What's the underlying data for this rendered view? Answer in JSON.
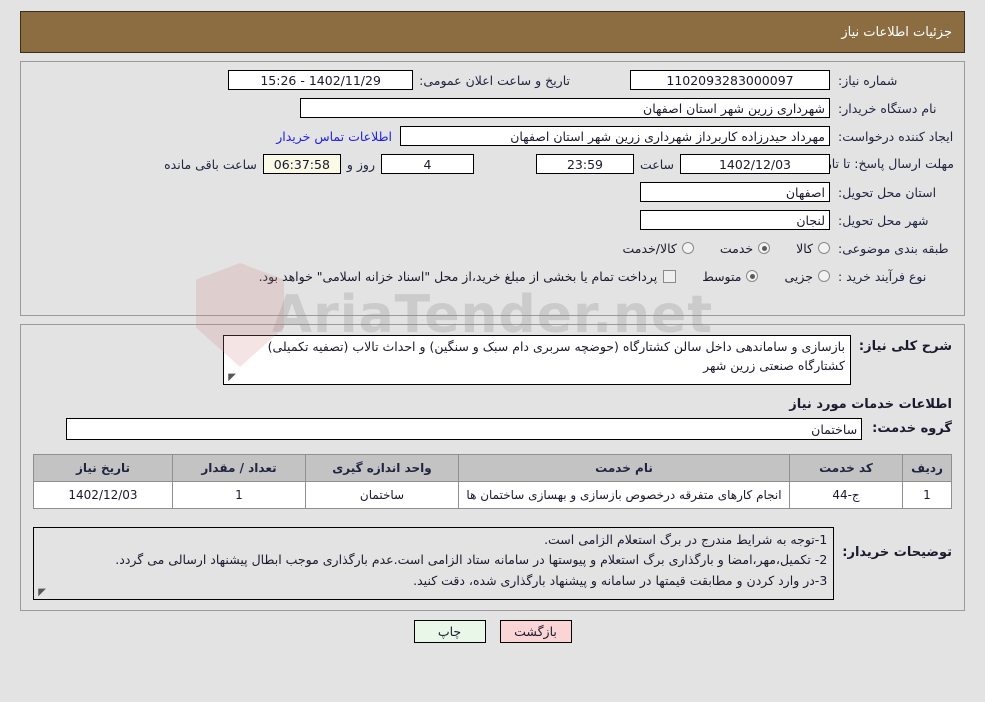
{
  "header": {
    "title": "جزئیات اطلاعات نیاز"
  },
  "form": {
    "need_number_label": "شماره نیاز:",
    "need_number_value": "1102093283000097",
    "announce_datetime_label": "تاریخ و ساعت اعلان عمومی:",
    "announce_datetime_value": "1402/11/29 - 15:26",
    "buyer_org_label": "نام دستگاه خریدار:",
    "buyer_org_value": "شهرداری زرین شهر استان اصفهان",
    "creator_label": "ایجاد کننده درخواست:",
    "creator_value": "مهرداد حیدرزاده کاربرداز شهرداری زرین شهر استان اصفهان",
    "buyer_contact_link": "اطلاعات تماس خریدار",
    "deadline_label": "مهلت ارسال پاسخ: تا تاریخ:",
    "deadline_date": "1402/12/03",
    "hour_label": "ساعت",
    "deadline_time": "23:59",
    "days_remaining": "4",
    "days_label": "روز و",
    "timer_value": "06:37:58",
    "remaining_label": "ساعت باقی مانده",
    "province_label": "استان محل تحویل:",
    "province_value": "اصفهان",
    "city_label": "شهر محل تحویل:",
    "city_value": "لنجان",
    "category_label": "طبقه بندی موضوعی:",
    "category_options": [
      {
        "label": "کالا",
        "selected": false
      },
      {
        "label": "خدمت",
        "selected": true
      },
      {
        "label": "کالا/خدمت",
        "selected": false
      }
    ],
    "process_label": "نوع فرآیند خرید :",
    "process_options": [
      {
        "label": "جزیی",
        "selected": false
      },
      {
        "label": "متوسط",
        "selected": true
      }
    ],
    "treasury_checkbox_checked": false,
    "treasury_text": "پرداخت تمام یا بخشی از مبلغ خرید،از محل \"اسناد خزانه اسلامی\" خواهد بود."
  },
  "description": {
    "label": "شرح کلی نیاز:",
    "value": "بازسازی و ساماندهی داخل سالن کشتارگاه (حوضچه سربری دام سبک و سنگین) و احداث تالاب (تصفیه تکمیلی) کشتارگاه صنعتی زرین شهر"
  },
  "services_section": {
    "heading": "اطلاعات خدمات مورد نیاز",
    "group_label": "گروه خدمت:",
    "group_value": "ساختمان"
  },
  "table": {
    "columns": [
      "ردیف",
      "کد خدمت",
      "نام خدمت",
      "واحد اندازه گیری",
      "تعداد / مقدار",
      "تاریخ نیاز"
    ],
    "rows": [
      {
        "row_no": "1",
        "service_code": "ج-44",
        "service_name": "انجام کارهای متفرقه درخصوص بازسازی و بهسازی ساختمان ها",
        "unit": "ساختمان",
        "quantity": "1",
        "need_date": "1402/12/03"
      }
    ]
  },
  "notes": {
    "label": "توضیحات خریدار:",
    "lines": [
      "1-توجه به شرایط مندرج در برگ استعلام الزامی است.",
      "2- تکمیل،مهر،امضا و بارگذاری برگ استعلام و پیوستها در سامانه ستاد الزامی است.عدم بارگذاری موجب ابطال پیشنهاد ارسالی می گردد.",
      "3-در وارد کردن و مطابقت قیمتها در سامانه و پیشنهاد بارگذاری شده، دقت کنید."
    ]
  },
  "footer": {
    "print_label": "چاپ",
    "back_label": "بازگشت"
  },
  "watermark": {
    "text": "AriaTender.net"
  },
  "colors": {
    "header_bar": "#8c6d42",
    "page_bg": "#e3e3e3",
    "link": "#2222dd",
    "timer_bg": "#fafae6",
    "table_header_bg": "#c3c3c3",
    "print_btn_bg": "#e8f7e8",
    "back_btn_bg": "#fbd5d5"
  }
}
